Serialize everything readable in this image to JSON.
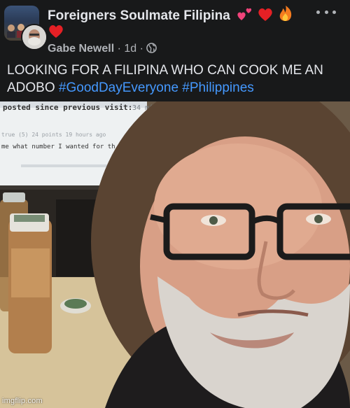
{
  "post": {
    "group_name": "Foreigners Soulmate Filipina",
    "group_emojis": [
      "revolving-hearts-emoji",
      "red-heart-emoji",
      "fire-emoji",
      "red-heart-emoji"
    ],
    "author": "Gabe Newell",
    "separator": "·",
    "time": "1d",
    "privacy_icon": "globe-icon",
    "body_text": "LOOKING FOR A FILIPINA WHO CAN COOK ME AN ADOBO ",
    "hashtags": [
      "#GoodDayEveryone",
      "#Philippines"
    ]
  },
  "photo": {
    "screen_text": {
      "line1": "posted since previous visit:",
      "line1_value": "34 min",
      "line2": "true  (5) 24 points 19 hours ago",
      "line3": "me what number I wanted for th"
    }
  },
  "watermark": "imgflip.com",
  "colors": {
    "background": "#18191a",
    "text": "#e4e6eb",
    "secondary_text": "#b0b3b8",
    "hashtag": "#4599ff"
  }
}
